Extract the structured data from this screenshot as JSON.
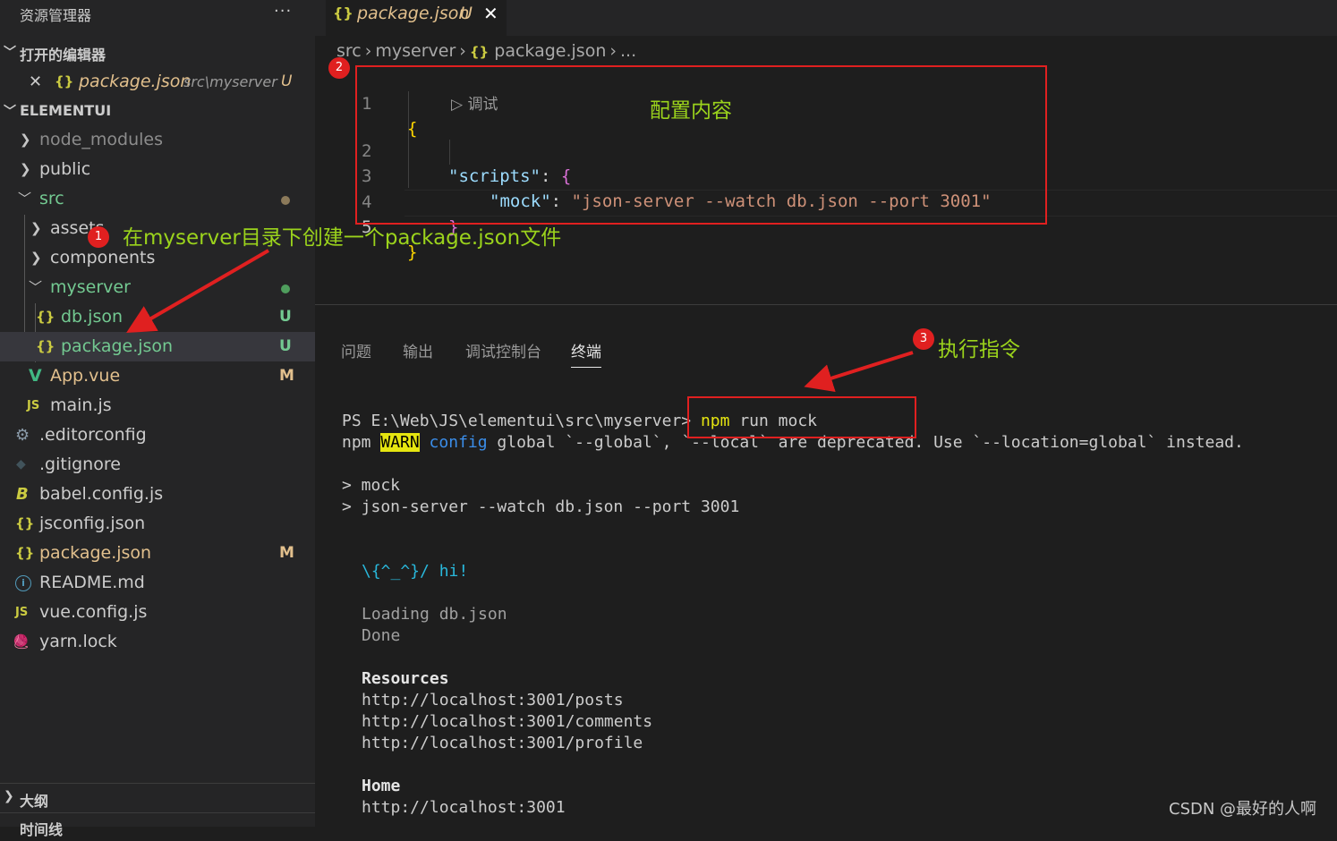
{
  "explorer": {
    "title": "资源管理器",
    "more": "···",
    "open_editors": {
      "title": "打开的编辑器",
      "items": [
        {
          "icon": "{}",
          "name": "package.json",
          "path": "src\\myserver",
          "status": "U"
        }
      ]
    },
    "project": {
      "title": "ELEMENTUI",
      "tree": [
        {
          "name": "node_modules",
          "icon": "",
          "badge": ""
        },
        {
          "name": "public",
          "icon": "",
          "badge": ""
        },
        {
          "name": "src",
          "icon": "",
          "badge": ""
        },
        {
          "name": "assets",
          "icon": "",
          "badge": ""
        },
        {
          "name": "components",
          "icon": "",
          "badge": ""
        },
        {
          "name": "myserver",
          "icon": "",
          "badge": ""
        },
        {
          "name": "db.json",
          "icon": "{}",
          "badge": "U"
        },
        {
          "name": "package.json",
          "icon": "{}",
          "badge": "U"
        },
        {
          "name": "App.vue",
          "icon": "V",
          "badge": "M"
        },
        {
          "name": "main.js",
          "icon": "JS",
          "badge": ""
        },
        {
          "name": ".editorconfig",
          "icon": "⚙",
          "badge": ""
        },
        {
          "name": ".gitignore",
          "icon": "◆",
          "badge": ""
        },
        {
          "name": "babel.config.js",
          "icon": "B",
          "badge": ""
        },
        {
          "name": "jsconfig.json",
          "icon": "{}",
          "badge": ""
        },
        {
          "name": "package.json",
          "icon": "{}",
          "badge": "M"
        },
        {
          "name": "README.md",
          "icon": "i",
          "badge": ""
        },
        {
          "name": "vue.config.js",
          "icon": "JS",
          "badge": ""
        },
        {
          "name": "yarn.lock",
          "icon": "🧶",
          "badge": ""
        }
      ]
    },
    "outline": "大纲",
    "timeline": "时间线"
  },
  "editor": {
    "tab": {
      "icon": "{}",
      "name": "package.json",
      "status": "U",
      "close": "✕"
    },
    "breadcrumb": [
      "src",
      "myserver",
      "package.json",
      "..."
    ],
    "codelens": "调试",
    "lines": [
      {
        "num": "1"
      },
      {
        "num": "2"
      },
      {
        "num": "3"
      },
      {
        "num": "4"
      },
      {
        "num": "5"
      }
    ],
    "code": {
      "open_brace": "{",
      "scripts_key": "\"scripts\"",
      "colon": ": ",
      "inner_open": "{",
      "mock_key": "\"mock\"",
      "mock_value": "\"json-server --watch db.json --port 3001\"",
      "inner_close": "}",
      "close_brace": "}"
    }
  },
  "panel": {
    "tabs": [
      "问题",
      "输出",
      "调试控制台",
      "终端"
    ],
    "terminal": {
      "prompt": "PS E:\\Web\\JS\\elementui\\src\\myserver> ",
      "cmd_npm": "npm",
      "cmd_rest": " run mock",
      "warn_npm": "npm ",
      "warn_tag": "WARN",
      "warn_config": " config",
      "warn_msg": " global `--global`, `--local` are deprecated. Use `--location=global` instead.",
      "out1": "> mock",
      "out2": "> json-server --watch db.json --port 3001",
      "hi": "\\{^_^}/ hi!",
      "loading": "Loading db.json",
      "done": "Done",
      "resources_title": "Resources",
      "resources": [
        "http://localhost:3001/posts",
        "http://localhost:3001/comments",
        "http://localhost:3001/profile"
      ],
      "home_title": "Home",
      "home_url": "http://localhost:3001"
    }
  },
  "annotations": {
    "n1": "1",
    "n2": "2",
    "n3": "3",
    "label1": "在myserver目录下创建一个package.json文件",
    "label2": "配置内容",
    "label3": "执行指令"
  },
  "watermark": "CSDN @最好的人啊",
  "colors": {
    "accent_red": "#e02020",
    "annotation_green": "#9bd31c",
    "untracked": "#73c991",
    "modified": "#e2c08d"
  }
}
